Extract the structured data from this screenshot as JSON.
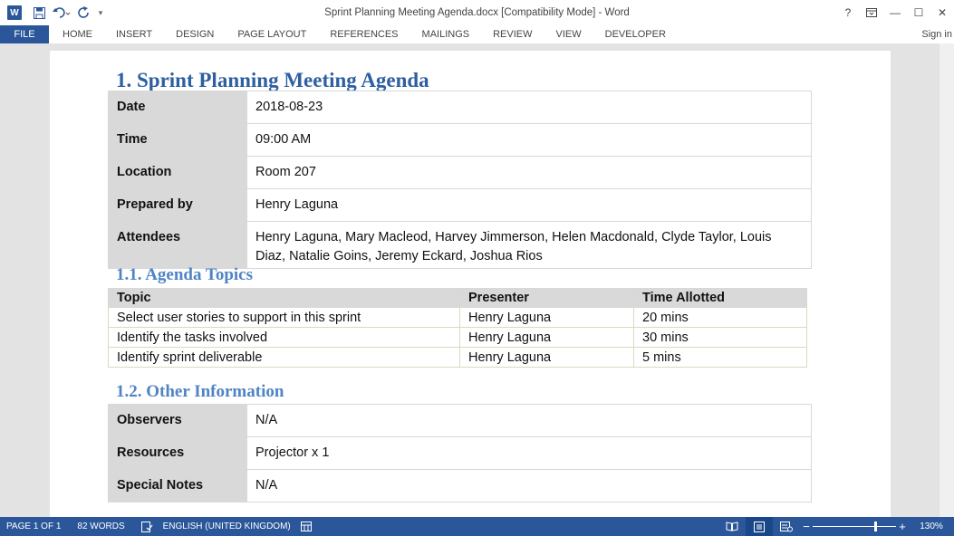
{
  "window": {
    "title": "Sprint Planning Meeting Agenda.docx [Compatibility Mode] - Word",
    "help": "?",
    "minimize": "—",
    "maximize": "☐",
    "close": "✕"
  },
  "ribbon": {
    "file_tab": "FILE",
    "tabs": [
      "HOME",
      "INSERT",
      "DESIGN",
      "PAGE LAYOUT",
      "REFERENCES",
      "MAILINGS",
      "REVIEW",
      "VIEW",
      "DEVELOPER"
    ],
    "sign_in": "Sign in"
  },
  "document": {
    "heading": "1. Sprint Planning Meeting Agenda",
    "meeting_info": [
      {
        "label": "Date",
        "value": "2018-08-23"
      },
      {
        "label": "Time",
        "value": "09:00 AM"
      },
      {
        "label": "Location",
        "value": "Room 207"
      },
      {
        "label": "Prepared by",
        "value": "Henry Laguna"
      },
      {
        "label": "Attendees",
        "value": "Henry Laguna, Mary Macleod, Harvey Jimmerson, Helen Macdonald, Clyde Taylor, Louis Diaz, Natalie Goins, Jeremy Eckard, Joshua Rios"
      }
    ],
    "agenda_heading": "1.1. Agenda Topics",
    "agenda_columns": [
      "Topic",
      "Presenter",
      "Time Allotted"
    ],
    "agenda_rows": [
      [
        "Select user stories to support in this sprint",
        "Henry Laguna",
        "20 mins"
      ],
      [
        "Identify the tasks involved",
        "Henry Laguna",
        "30 mins"
      ],
      [
        "Identify sprint deliverable",
        "Henry Laguna",
        "5 mins"
      ]
    ],
    "other_heading": "1.2. Other Information",
    "other_info": [
      {
        "label": "Observers",
        "value": "N/A"
      },
      {
        "label": "Resources",
        "value": "Projector x 1"
      },
      {
        "label": "Special Notes",
        "value": "N/A"
      }
    ]
  },
  "status": {
    "page": "PAGE 1 OF 1",
    "words": "82 WORDS",
    "language": "ENGLISH (UNITED KINGDOM)",
    "zoom_minus": "−",
    "zoom_plus": "+",
    "zoom": "130%",
    "zoom_level_percent": 130
  },
  "colors": {
    "accent": "#2b579a",
    "heading": "#2e5fa1",
    "subheading": "#4f84c4",
    "label_bg": "#d9d9d9"
  }
}
